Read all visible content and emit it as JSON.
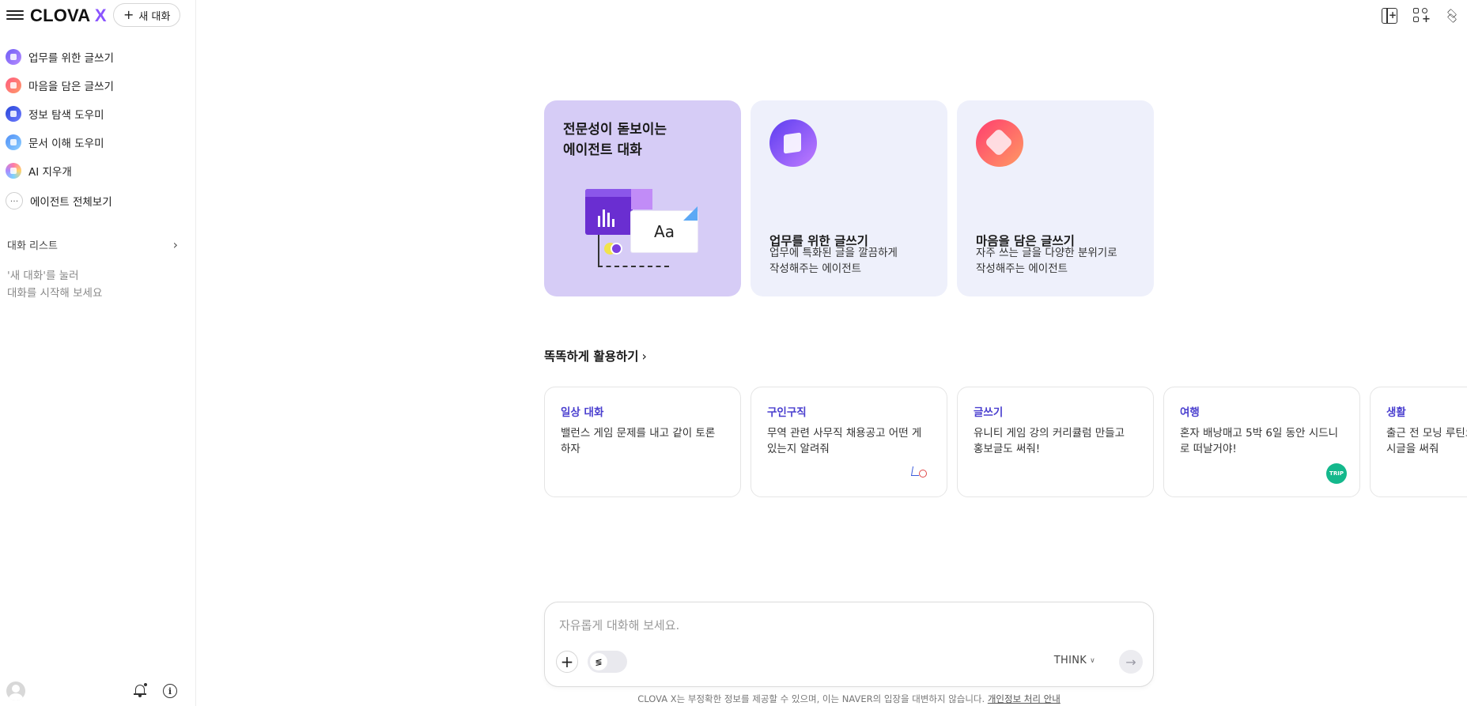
{
  "app": {
    "logo_text": "CLOVA",
    "logo_x": "X",
    "accent_color": "#8a54ff"
  },
  "sidebar": {
    "new_chat_label": "새 대화",
    "agents": [
      {
        "label": "업무를 위한 글쓰기",
        "icon": "book-agent-icon"
      },
      {
        "label": "마음을 담은 글쓰기",
        "icon": "heart-agent-icon"
      },
      {
        "label": "정보 탐색 도우미",
        "icon": "compass-agent-icon"
      },
      {
        "label": "문서 이해 도우미",
        "icon": "document-agent-icon"
      },
      {
        "label": "AI 지우개",
        "icon": "eraser-agent-icon"
      }
    ],
    "all_agents_label": "에이전트 전체보기",
    "chat_list_label": "대화 리스트",
    "empty_hint": "'새 대화'를 눌러\n대화를 시작해 보세요"
  },
  "hero": {
    "main_title": "전문성이 돋보이는\n에이전트 대화",
    "main_illustration_text": "Aa",
    "cards": [
      {
        "name": "업무를 위한 글쓰기",
        "desc": "업무에 특화된 글을 깔끔하게\n작성해주는 에이전트",
        "icon": "book-icon"
      },
      {
        "name": "마음을 담은 글쓰기",
        "desc": "자주 쓰는 글을 다양한 분위기로\n작성해주는 에이전트",
        "icon": "heart-icon"
      }
    ]
  },
  "suggestions": {
    "title": "똑똑하게 활용하기",
    "items": [
      {
        "category": "일상 대화",
        "text": "밸런스 게임 문제를 내고 같이 토론\n하자"
      },
      {
        "category": "구인구직",
        "text": "무역 관련 사무직 채용공고 어떤 게\n있는지 알려줘"
      },
      {
        "category": "글쓰기",
        "text": "유니티 게임 강의 커리큘럼 만들고\n홍보글도 써줘!"
      },
      {
        "category": "여행",
        "text": "혼자 배낭매고 5박 6일 동안 시드니\n로 떠날거야!",
        "badge": "TRIP"
      },
      {
        "category": "생활",
        "text": "출근 전 모닝 루틴으\n시글을 써줘"
      }
    ]
  },
  "input": {
    "placeholder": "자유롭게 대화해 보세요.",
    "think_label": "THINK",
    "send_symbol": "→"
  },
  "disclaimer": {
    "text": "CLOVA X는 부정확한 정보를 제공할 수 있으며, 이는 NAVER의 입장을 대변하지 않습니다. ",
    "link": "개인정보 처리 안내"
  }
}
